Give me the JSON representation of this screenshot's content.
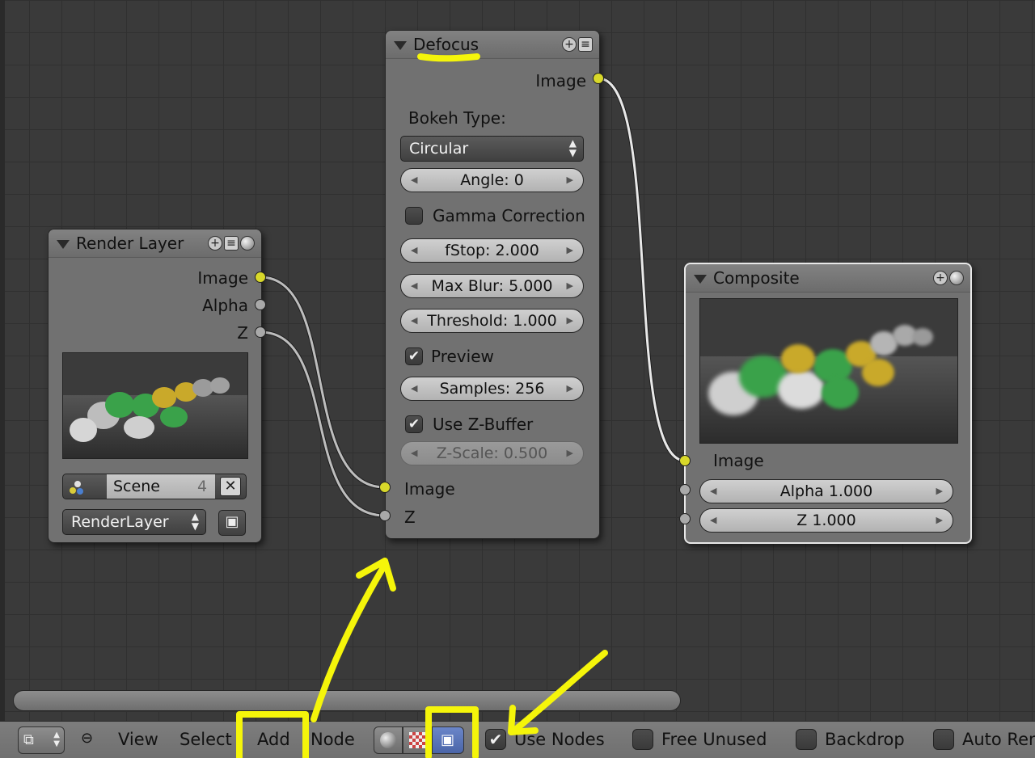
{
  "editor": {
    "nodes": {
      "render_layer": {
        "title": "Render Layer",
        "outputs": [
          "Image",
          "Alpha",
          "Z"
        ],
        "scene_name": "Scene",
        "scene_users": "4",
        "layer": "RenderLayer"
      },
      "defocus": {
        "title": "Defocus",
        "output": "Image",
        "bokeh_label": "Bokeh Type:",
        "bokeh_value": "Circular",
        "angle": "Angle: 0",
        "gamma_label": "Gamma Correction",
        "gamma_checked": false,
        "fstop": "fStop: 2.000",
        "max_blur": "Max Blur: 5.000",
        "threshold": "Threshold: 1.000",
        "preview_label": "Preview",
        "preview_checked": true,
        "samples": "Samples: 256",
        "zbuffer_label": "Use Z-Buffer",
        "zbuffer_checked": true,
        "zscale": "Z-Scale: 0.500",
        "inputs": [
          "Image",
          "Z"
        ]
      },
      "composite": {
        "title": "Composite",
        "input_image": "Image",
        "alpha": "Alpha 1.000",
        "z": "Z 1.000"
      }
    }
  },
  "toolbar": {
    "menu": [
      "View",
      "Select",
      "Add",
      "Node"
    ],
    "use_nodes_label": "Use Nodes",
    "use_nodes_checked": true,
    "free_unused_label": "Free Unused",
    "backdrop_label": "Backdrop",
    "auto_render_label": "Auto Ren"
  },
  "colors": {
    "socket_image": "#d8d82a",
    "socket_value": "#a9a9a9",
    "annotation": "#f5f50a"
  }
}
